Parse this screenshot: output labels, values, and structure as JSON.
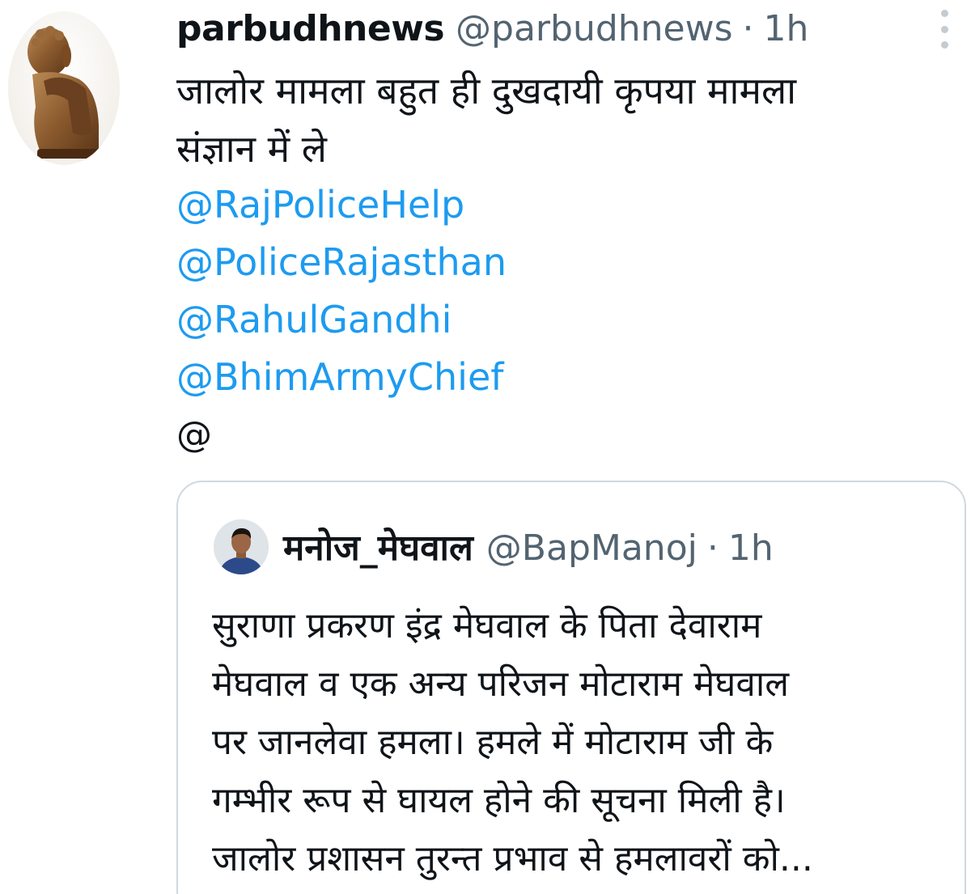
{
  "tweet": {
    "author_name": "parbudhnews",
    "author_handle": "@parbudhnews",
    "separator": "·",
    "time": "1h",
    "text_lines": [
      "जालोर मामला बहुत ही दुखदायी कृपया मामला",
      "संज्ञान में ले"
    ],
    "mentions": [
      "@RajPoliceHelp",
      "@PoliceRajasthan",
      "@RahulGandhi",
      "@BhimArmyChief"
    ],
    "trailing": "@",
    "avatar_icon": "buddha-statue-avatar-icon",
    "more_icon": "more-vertical-icon"
  },
  "quoted_tweet": {
    "author_name": "मनोज_मेघवाल",
    "author_handle": "@BapManoj",
    "separator": "·",
    "time": "1h",
    "avatar_icon": "user-photo-avatar-icon",
    "text_lines": [
      "सुराणा प्रकरण इंद्र मेघवाल के पिता देवाराम",
      "मेघवाल व एक अन्य परिजन मोटाराम मेघवाल",
      "पर जानलेवा हमला। हमले में मोटाराम जी के",
      "गम्भीर रूप से घायल होने की सूचना मिली है।",
      "जालोर प्रशासन तुरन्त प्रभाव से हमलावरों को..."
    ]
  },
  "colors": {
    "text": "#0f1419",
    "secondary": "#536471",
    "link": "#1d9bf0",
    "border": "#cfd9de"
  }
}
